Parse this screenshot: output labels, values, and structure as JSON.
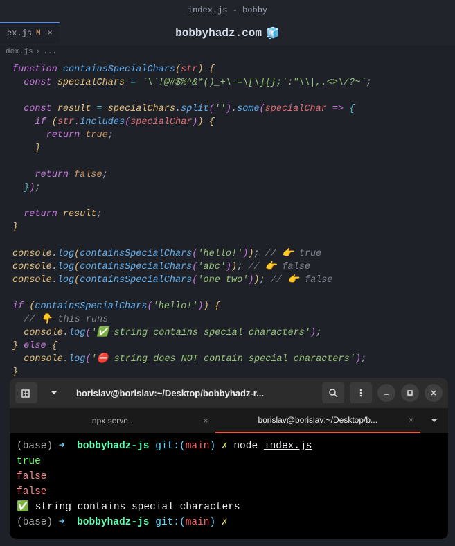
{
  "titleBar": "index.js - bobby",
  "tab": {
    "name": "ex.js",
    "modified": "M",
    "close": "×"
  },
  "watermark": {
    "text": "bobbyhadz.com",
    "icon": "🧊"
  },
  "breadcrumb": {
    "file": "dex.js",
    "sep": "›",
    "dots": "..."
  },
  "code": {
    "l1": {
      "kw": "function",
      "fn": "containsSpecialChars",
      "param": "str"
    },
    "l2": {
      "kw": "const",
      "var": "specialChars",
      "str": "`\\`!@#$%^&*()_+\\-=\\[\\]{};':\"\\\\|,.<>\\/?~`"
    },
    "l3": {
      "kw": "const",
      "var": "result",
      "obj": "specialChars",
      "m1": "split",
      "s1": "''",
      "m2": "some",
      "p": "specialChar"
    },
    "l4": {
      "kw": "if",
      "obj": "str",
      "m": "includes",
      "p": "specialChar"
    },
    "l5": {
      "kw": "return",
      "val": "true"
    },
    "l6": {
      "kw": "return",
      "val": "false"
    },
    "l7": {
      "kw": "return",
      "var": "result"
    },
    "log1": {
      "obj": "console",
      "m": "log",
      "fn": "containsSpecialChars",
      "s": "'hello!'",
      "cmt": "// 👉️ true"
    },
    "log2": {
      "obj": "console",
      "m": "log",
      "fn": "containsSpecialChars",
      "s": "'abc'",
      "cmt": "// 👉️ false"
    },
    "log3": {
      "obj": "console",
      "m": "log",
      "fn": "containsSpecialChars",
      "s": "'one two'",
      "cmt": "// 👉️ false"
    },
    "if2": {
      "kw": "if",
      "fn": "containsSpecialChars",
      "s": "'hello!'"
    },
    "cmt1": "// 👇️ this runs",
    "log4": {
      "obj": "console",
      "m": "log",
      "s": "'✅ string contains special characters'"
    },
    "else": "else",
    "log5": {
      "obj": "console",
      "m": "log",
      "s": "'⛔️ string does NOT contain special characters'"
    }
  },
  "terminal": {
    "title": "borislav@borislav:~/Desktop/bobbyhadz-r...",
    "tabs": [
      {
        "label": "npx serve .",
        "active": false
      },
      {
        "label": "borislav@borislav:~/Desktop/b...",
        "active": true
      }
    ],
    "prompt": {
      "base": "(base)",
      "arrow": "➜",
      "dir": "bobbyhadz-js",
      "git": "git:(",
      "branch": "main",
      "gitc": ")",
      "x": "✗"
    },
    "cmd": {
      "bin": "node",
      "file": "index.js"
    },
    "out": [
      "true",
      "false",
      "false",
      "✅ string contains special characters"
    ]
  }
}
